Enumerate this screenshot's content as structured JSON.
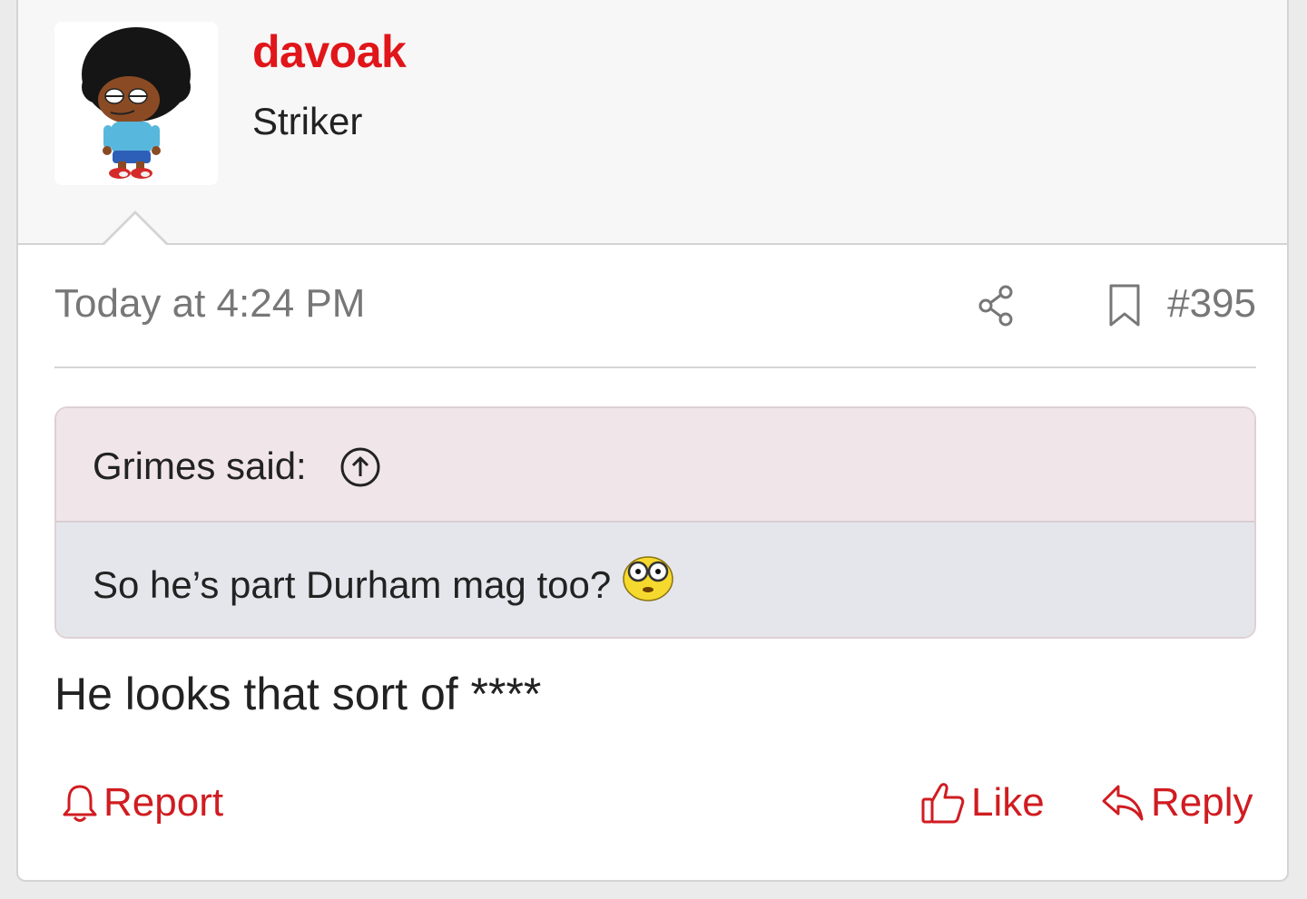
{
  "user": {
    "name": "davoak",
    "title": "Striker"
  },
  "meta": {
    "timestamp": "Today at 4:24 PM",
    "post_number": "#395"
  },
  "quote": {
    "author": "Grimes said:",
    "text": "So he’s part Durham mag too?"
  },
  "message": "He looks that sort of ****",
  "actions": {
    "report": "Report",
    "like": "Like",
    "reply": "Reply"
  },
  "icons": {
    "share": "share-icon",
    "bookmark": "bookmark-icon",
    "quote_jump": "arrow-up-circle-icon",
    "emoji": "shocked-glasses-emoji-icon",
    "report": "bell-icon",
    "like": "thumbs-up-icon",
    "reply": "reply-arrow-icon"
  },
  "colors": {
    "accent": "#e0161a",
    "action": "#d01c21",
    "quote_header_bg": "#f0e5e8",
    "quote_body_bg": "#e4e6eb"
  }
}
